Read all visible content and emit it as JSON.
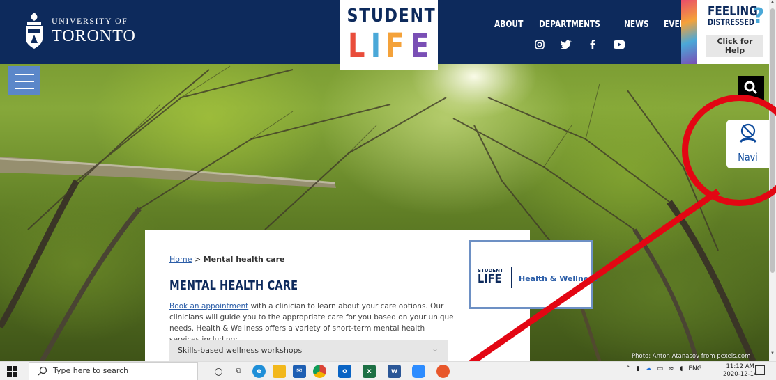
{
  "header": {
    "university_line1": "UNIVERSITY OF",
    "university_line2": "TORONTO",
    "brand_student": "STUDENT",
    "brand_life_letters": [
      "L",
      "I",
      "F",
      "E"
    ],
    "brand_life_colors": [
      "#e94d3b",
      "#4aa8d8",
      "#f4a23a",
      "#7a4fb5"
    ],
    "nav": [
      "ABOUT",
      "DEPARTMENTS",
      "NEWS",
      "EVENTS"
    ],
    "socials": [
      "instagram-icon",
      "twitter-icon",
      "facebook-icon",
      "youtube-icon"
    ],
    "distress_feeling": "FEELING",
    "distress_distressed": "DISTRESSED",
    "distress_qmark": "?",
    "help_button": "Click for Help"
  },
  "widgets": {
    "navi_label": "Navi"
  },
  "content": {
    "breadcrumb_home": "Home",
    "breadcrumb_separator": " > ",
    "breadcrumb_current": "Mental health care",
    "title": "MENTAL HEALTH CARE",
    "intro_link": "Book an appointment",
    "intro_rest": " with a clinician to learn about your care options. Our clinicians will guide you to the appropriate care for you based on your unique needs. Health & Wellness offers a variety of short-term mental health services including:",
    "accordion_first": "Skills-based wellness workshops"
  },
  "hw_card": {
    "sl_small": "STUDENT",
    "sl_big": "LIFE",
    "label": "Health & Wellness"
  },
  "photo_credit": "Photo: Anton Atanasov from pexels.com",
  "taskbar": {
    "search_placeholder": "Type here to search",
    "tray_lang": "ENG",
    "clock_time": "11:12 AM",
    "clock_date": "2020-12-14"
  },
  "colors": {
    "header_bg": "#0d2a5c",
    "accent_blue": "#2c5ea8",
    "annotation_red": "#e30613"
  }
}
